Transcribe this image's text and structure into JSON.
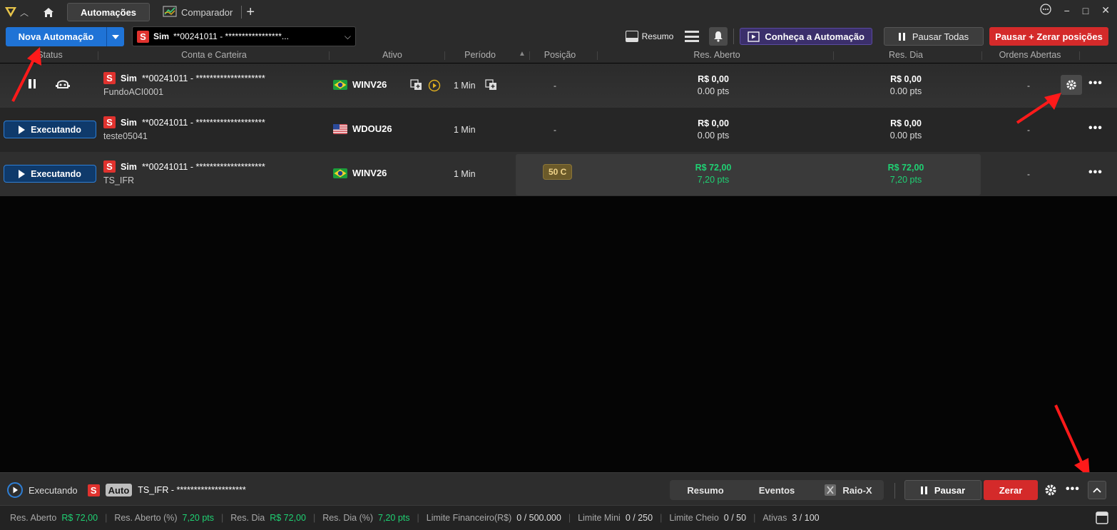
{
  "titlebar": {
    "tabs": [
      {
        "label": "Automações",
        "active": true
      },
      {
        "label": "Comparador",
        "active": false
      }
    ],
    "add_tab": "+",
    "window_controls": [
      "−",
      "□",
      "✕"
    ]
  },
  "toolbar": {
    "nova_automacao": "Nova Automação",
    "account_select": {
      "badge": "S",
      "account": "Sim",
      "value": "**00241011 - *****************..."
    },
    "resumo_label": "Resumo",
    "conheca_label": "Conheça a Automação",
    "pausar_todas_label": "Pausar Todas",
    "pausar_zerar_label": "Pausar + Zerar posições"
  },
  "columns": {
    "status": "Status",
    "conta": "Conta e Carteira",
    "ativo": "Ativo",
    "periodo": "Período",
    "posicao": "Posição",
    "res_aberto": "Res. Aberto",
    "res_dia": "Res. Dia",
    "ordens": "Ordens Abertas"
  },
  "rows": [
    {
      "status": "",
      "account_badge": "S",
      "account_type": "Sim",
      "account_number": "**00241011 - ********************",
      "portfolio": "FundoACI0001",
      "flag": "brazil",
      "ativo": "WINV26",
      "periodo": "1 Min",
      "posicao": "-",
      "res_aberto_brl": "R$ 0,00",
      "res_aberto_pts": "0.00 pts",
      "res_dia_brl": "R$ 0,00",
      "res_dia_pts": "0.00 pts",
      "ordens": "-"
    },
    {
      "status": "Executando",
      "account_badge": "S",
      "account_type": "Sim",
      "account_number": "**00241011 - ********************",
      "portfolio": "teste05041",
      "flag": "usa",
      "ativo": "WDOU26",
      "periodo": "1 Min",
      "posicao": "-",
      "res_aberto_brl": "R$ 0,00",
      "res_aberto_pts": "0.00 pts",
      "res_dia_brl": "R$ 0,00",
      "res_dia_pts": "0.00 pts",
      "ordens": "-"
    },
    {
      "status": "Executando",
      "account_badge": "S",
      "account_type": "Sim",
      "account_number": "**00241011 - ********************",
      "portfolio": "TS_IFR",
      "flag": "brazil",
      "ativo": "WINV26",
      "periodo": "1 Min",
      "posicao": "50 C",
      "res_aberto_brl": "R$ 72,00",
      "res_aberto_pts": "7,20 pts",
      "res_dia_brl": "R$ 72,00",
      "res_dia_pts": "7,20 pts",
      "ordens": "-"
    }
  ],
  "bottombar": {
    "status": "Executando",
    "badge": "S",
    "auto_badge": "Auto",
    "name": "TS_IFR - ********************",
    "tabs": [
      "Resumo",
      "Eventos",
      "Raio-X"
    ],
    "pausar": "Pausar",
    "zerar": "Zerar"
  },
  "statusbar": {
    "res_aberto_label": "Res. Aberto",
    "res_aberto": "R$ 72,00",
    "res_aberto_pct_label": "Res. Aberto (%)",
    "res_aberto_pct": "7,20 pts",
    "res_dia_label": "Res. Dia",
    "res_dia": "R$ 72,00",
    "res_dia_pct_label": "Res. Dia (%)",
    "res_dia_pct": "7,20 pts",
    "limite_fin_label": "Limite Financeiro(R$)",
    "limite_fin": "0 / 500.000",
    "limite_mini_label": "Limite Mini",
    "limite_mini": "0 / 250",
    "limite_cheio_label": "Limite Cheio",
    "limite_cheio": "0 / 50",
    "ativas_label": "Ativas",
    "ativas": "3 / 100"
  },
  "colors": {
    "accent_blue": "#1f73d6",
    "danger_red": "#d42a2a",
    "profit_green": "#1fd173",
    "annotation_red": "#ff1a1a"
  }
}
